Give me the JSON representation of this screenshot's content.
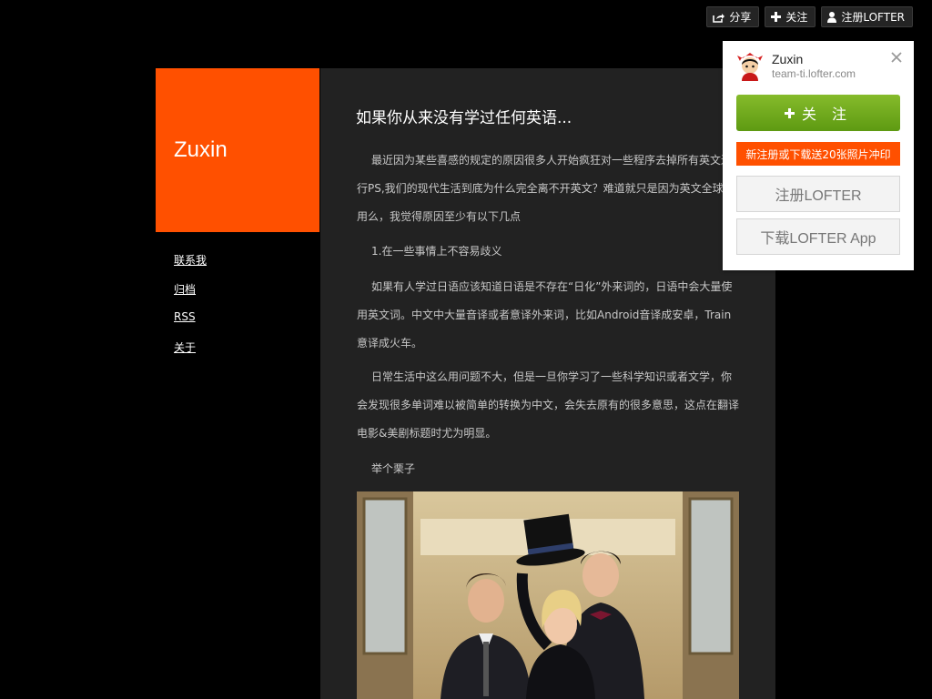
{
  "topbar": {
    "share_label": "分享",
    "follow_label": "关注",
    "register_label": "注册LOFTER"
  },
  "blog": {
    "title": "Zuxin",
    "nav": [
      "联系我",
      "归档",
      "RSS",
      "关于"
    ]
  },
  "post": {
    "title": "如果你从来没有学过任何英语...",
    "paragraphs": [
      "最近因为某些喜感的规定的原因很多人开始疯狂对一些程序去掉所有英文还行PS,我们的现代生活到底为什么完全离不开英文？难道就只是因为英文全球在用么，我觉得原因至少有以下几点",
      "1.在一些事情上不容易歧义",
      "如果有人学过日语应该知道日语是不存在“日化”外来词的，日语中会大量使用英文词。中文中大量音译或者意译外来词，比如Android音译成安卓，Train意译成火车。",
      "日常生活中这么用问题不大，但是一旦你学习了一些科学知识或者文学，你会发现很多单词难以被简单的转换为中文，会失去原有的很多意思，这点在翻译电影&美剧标题时尤为明显。",
      "举个栗子"
    ]
  },
  "card": {
    "name": "Zuxin",
    "url": "team-ti.lofter.com",
    "follow_label": "关 注",
    "promo": "新注册或下载送20张照片冲印",
    "register_label": "注册LOFTER",
    "download_label": "下载LOFTER App"
  },
  "colors": {
    "accent": "#ff5000",
    "follow_green": "#6aa81a",
    "background": "#000000",
    "content_bg": "#222222"
  },
  "icons": {
    "share": "share-icon",
    "plus": "plus-icon",
    "user": "user-icon",
    "close": "close-icon"
  }
}
